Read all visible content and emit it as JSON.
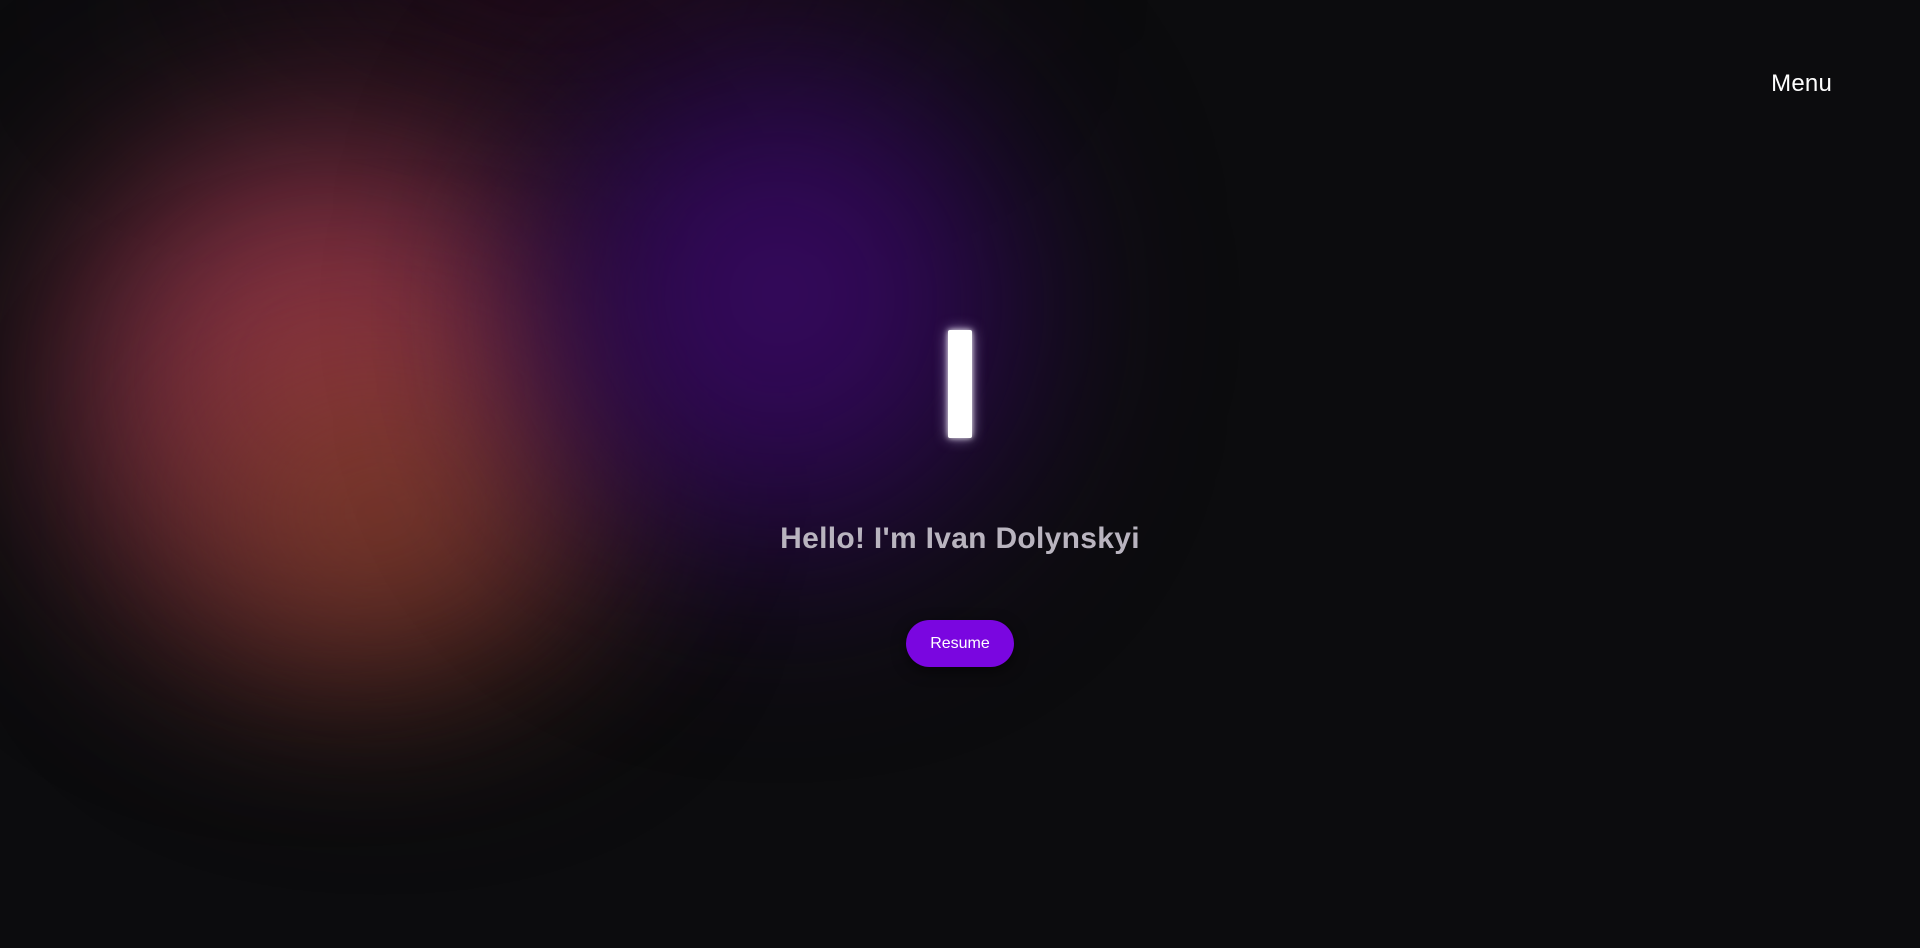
{
  "header": {
    "menu_label": "Menu"
  },
  "hero": {
    "greeting": "Hello! I'm Ivan Dolynskyi",
    "resume_label": "Resume"
  },
  "colors": {
    "background": "#0c0c0e",
    "accent": "#7a06e0",
    "glow_red": "#9a3a3e",
    "glow_purple": "#3c0a66",
    "greeting_text": "#b9b4bf"
  }
}
